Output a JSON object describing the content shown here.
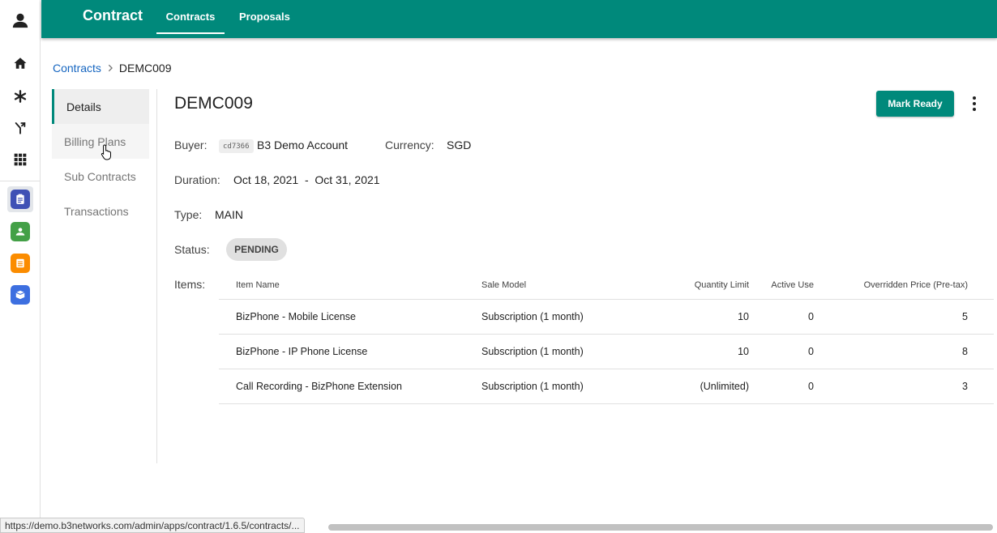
{
  "header": {
    "app_title": "Contract",
    "tabs": [
      {
        "label": "Contracts",
        "active": true
      },
      {
        "label": "Proposals",
        "active": false
      }
    ],
    "color": "#00897b"
  },
  "rail": {
    "icons": [
      "user-icon",
      "home-icon",
      "asterisk-icon",
      "merge-icon",
      "apps-grid-icon"
    ],
    "apps": [
      {
        "name": "contract-app-icon",
        "color": "#3f51b5",
        "active": true
      },
      {
        "name": "people-app-icon",
        "color": "#43a047",
        "active": false
      },
      {
        "name": "notes-app-icon",
        "color": "#fb8c00",
        "active": false
      },
      {
        "name": "box-app-icon",
        "color": "#3d6fe0",
        "active": false
      }
    ]
  },
  "breadcrumb": {
    "parent": "Contracts",
    "current": "DEMC009"
  },
  "sidenav": {
    "items": [
      {
        "label": "Details"
      },
      {
        "label": "Billing Plans"
      },
      {
        "label": "Sub Contracts"
      },
      {
        "label": "Transactions"
      }
    ]
  },
  "contract": {
    "title": "DEMC009",
    "mark_ready_label": "Mark Ready",
    "buyer_label": "Buyer:",
    "buyer_code": "cd7366",
    "buyer_name": "B3 Demo Account",
    "currency_label": "Currency:",
    "currency": "SGD",
    "duration_label": "Duration:",
    "duration": "Oct 18, 2021  -  Oct 31, 2021",
    "type_label": "Type:",
    "type": "MAIN",
    "status_label": "Status:",
    "status": "PENDING",
    "items_label": "Items:"
  },
  "items_table": {
    "headers": [
      "Item Name",
      "Sale Model",
      "Quantity Limit",
      "Active Use",
      "Overridden Price (Pre-tax)"
    ],
    "rows": [
      [
        "BizPhone - Mobile License",
        "Subscription (1 month)",
        "10",
        "0",
        "5"
      ],
      [
        "BizPhone - IP Phone License",
        "Subscription (1 month)",
        "10",
        "0",
        "8"
      ],
      [
        "Call Recording - BizPhone Extension",
        "Subscription (1 month)",
        "(Unlimited)",
        "0",
        "3"
      ]
    ]
  },
  "statusbar": {
    "url": "https://demo.b3networks.com/admin/apps/contract/1.6.5/contracts/..."
  }
}
